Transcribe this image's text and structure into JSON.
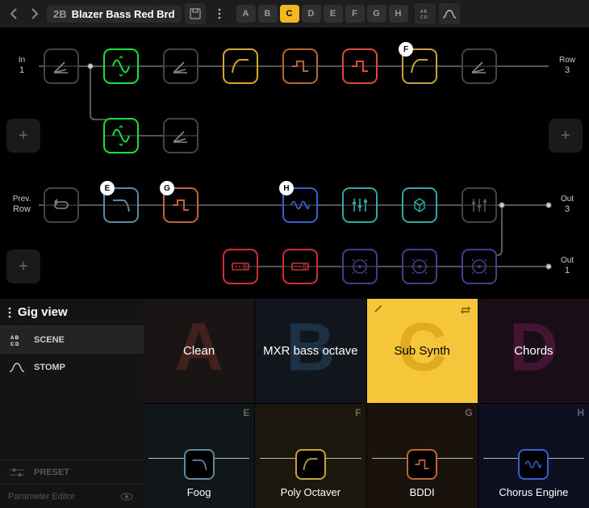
{
  "header": {
    "prefix": "2B",
    "name": "Blazer Bass Red Brd",
    "scenes": [
      "A",
      "B",
      "C",
      "D",
      "E",
      "F",
      "G",
      "H"
    ],
    "active_scene": "C"
  },
  "rows": {
    "r1": {
      "in_label": "In",
      "in_num": "1",
      "out_label": "Row",
      "out_num": "3",
      "slots": [
        {
          "x": 0,
          "kind": "split",
          "color": "#555"
        },
        {
          "x": 1,
          "kind": "osc",
          "color": "#17e23a"
        },
        {
          "x": 2,
          "kind": "split",
          "color": "#555"
        },
        {
          "x": 3,
          "kind": "filter",
          "color": "#d9a62a"
        },
        {
          "x": 4,
          "kind": "wave",
          "color": "#b4672e"
        },
        {
          "x": 5,
          "kind": "wave",
          "color": "#e04a3a"
        },
        {
          "x": 6,
          "kind": "filter",
          "color": "#c6a23c",
          "badge": "F"
        },
        {
          "x": 7,
          "kind": "split",
          "color": "#555"
        }
      ]
    },
    "r2": {
      "plus_left": true,
      "plus_right": true,
      "slots": [
        {
          "x": 1,
          "kind": "osc",
          "color": "#17e23a"
        },
        {
          "x": 2,
          "kind": "split",
          "color": "#555"
        }
      ]
    },
    "r3": {
      "left_label": "Prev.",
      "left_sub": "Row",
      "out_label": "Out",
      "out_num": "3",
      "slots": [
        {
          "x": 0,
          "kind": "loop",
          "color": "#555"
        },
        {
          "x": 1,
          "kind": "lpf",
          "color": "#5b8aa6",
          "badge": "E"
        },
        {
          "x": 2,
          "kind": "wave",
          "color": "#c1643a",
          "badge": "G"
        },
        {
          "x": 4,
          "kind": "mod",
          "color": "#3a5fd0",
          "badge": "H"
        },
        {
          "x": 5,
          "kind": "eq",
          "color": "#2fa9a0"
        },
        {
          "x": 6,
          "kind": "cube",
          "color": "#2fa9a0"
        },
        {
          "x": 7,
          "kind": "eq",
          "color": "#555"
        }
      ]
    },
    "r4": {
      "plus_left": true,
      "out_label": "Out",
      "out_num": "1",
      "slots": [
        {
          "x": 3,
          "kind": "rack",
          "color": "#d12f2f"
        },
        {
          "x": 4,
          "kind": "rack",
          "color": "#d12f2f"
        },
        {
          "x": 5,
          "kind": "knob",
          "color": "#443f8a"
        },
        {
          "x": 6,
          "kind": "knob",
          "color": "#443f8a"
        },
        {
          "x": 7,
          "kind": "knob",
          "color": "#443f8a"
        }
      ]
    }
  },
  "gigview": {
    "title": "Gig view",
    "modes": {
      "scene": "SCENE",
      "stomp": "STOMP"
    },
    "preset": "PRESET",
    "param_editor": "Parameter Editor"
  },
  "cards": {
    "top": [
      {
        "letter": "A",
        "title": "Clean",
        "bg": "#1a1515",
        "fg": "#42201e"
      },
      {
        "letter": "B",
        "title": "MXR bass octave",
        "bg": "#11161c",
        "fg": "#1d3145"
      },
      {
        "letter": "C",
        "title": "Sub Synth",
        "bg": "#f5c53a",
        "fg": "#e0ab1e",
        "active": true
      },
      {
        "letter": "D",
        "title": "Chords",
        "bg": "#190d16",
        "fg": "#421633"
      }
    ],
    "bottom": [
      {
        "letter": "E",
        "title": "Foog",
        "bg": "#111619",
        "thumb": "lpf",
        "thumb_color": "#5b8aa6"
      },
      {
        "letter": "F",
        "title": "Poly Octaver",
        "bg": "#1b170c",
        "thumb": "filter",
        "thumb_color": "#c6a23c"
      },
      {
        "letter": "G",
        "title": "BDDI",
        "bg": "#1a120d",
        "thumb": "wave",
        "thumb_color": "#c1643a"
      },
      {
        "letter": "H",
        "title": "Chorus Engine",
        "bg": "#0e1022",
        "thumb": "mod",
        "thumb_color": "#3a5fd0"
      }
    ]
  }
}
